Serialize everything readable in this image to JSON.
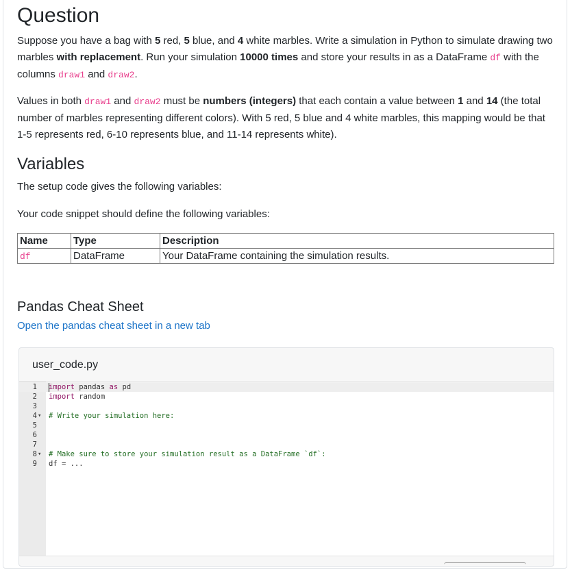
{
  "question": {
    "heading": "Question",
    "p1": {
      "t1": "Suppose you have a bag with ",
      "n_red": "5",
      "t2": " red, ",
      "n_blue": "5",
      "t3": " blue, and ",
      "n_white": "4",
      "t4": " white marbles. Write a simulation in Python to simulate drawing two marbles ",
      "with_replacement": "with replacement",
      "t5": ". Run your simulation ",
      "times": "10000 times",
      "t6": " and store your results in as a DataFrame ",
      "df": "df",
      "t7": " with the columns ",
      "draw1": "draw1",
      "t8": " and ",
      "draw2": "draw2",
      "t9": "."
    },
    "p2": {
      "t1": "Values in both ",
      "draw1": "draw1",
      "t2": " and ",
      "draw2": "draw2",
      "t3": " must be ",
      "numbers": "numbers (integers)",
      "t4": " that each contain a value between ",
      "one": "1",
      "t5": " and ",
      "fourteen": "14",
      "t6": " (the total number of marbles representing different colors). With 5 red, 5 blue and 4 white marbles, this mapping would be that 1-5 represents red, 6-10 represents blue, and 11-14 represents white)."
    }
  },
  "variables": {
    "heading": "Variables",
    "setup_text": "The setup code gives the following variables:",
    "define_text": "Your code snippet should define the following variables:",
    "columns": [
      "Name",
      "Type",
      "Description"
    ],
    "rows": [
      {
        "name": "df",
        "type": "DataFrame",
        "description": "Your DataFrame containing the simulation results."
      }
    ]
  },
  "cheat_sheet": {
    "heading": "Pandas Cheat Sheet",
    "link_text": "Open the pandas cheat sheet in a new tab"
  },
  "editor": {
    "filename": "user_code.py",
    "lines": [
      {
        "n": "1",
        "fold": false,
        "kind": "import",
        "kw": "import",
        "rest1": " pandas ",
        "kw2": "as",
        "rest2": " pd"
      },
      {
        "n": "2",
        "fold": false,
        "kind": "import2",
        "kw": "import",
        "rest1": " random"
      },
      {
        "n": "3",
        "fold": false,
        "kind": "blank"
      },
      {
        "n": "4",
        "fold": true,
        "kind": "comment",
        "text": "# Write your simulation here:"
      },
      {
        "n": "5",
        "fold": false,
        "kind": "blank"
      },
      {
        "n": "6",
        "fold": false,
        "kind": "blank"
      },
      {
        "n": "7",
        "fold": false,
        "kind": "blank"
      },
      {
        "n": "8",
        "fold": true,
        "kind": "comment",
        "text": "# Make sure to store your simulation result as a DataFrame `df`:"
      },
      {
        "n": "9",
        "fold": false,
        "kind": "code",
        "text": "df = ..."
      }
    ],
    "fold_glyph": "▾"
  }
}
